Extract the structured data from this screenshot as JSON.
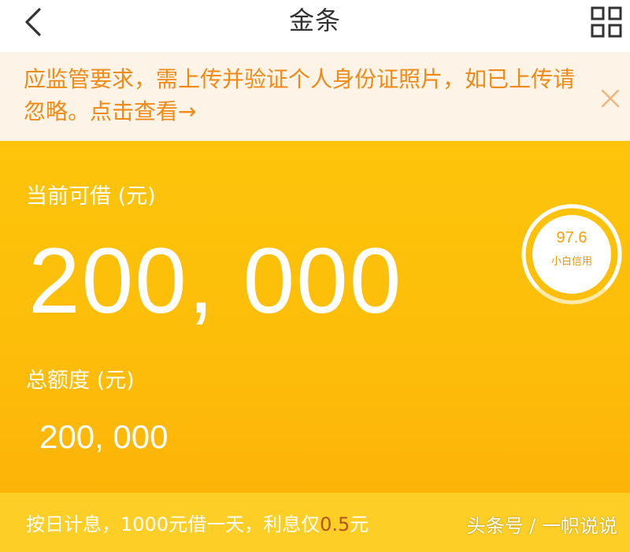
{
  "header": {
    "title": "金条",
    "back_icon": "chevron-left-icon",
    "menu_icon": "grid-icon"
  },
  "notice": {
    "text": "应监管要求，需上传并验证个人身份证照片，如已上传请忽略。点击查看→",
    "close_icon": "close-icon",
    "color": "#f08a17",
    "background": "#fdf3e7"
  },
  "credit": {
    "available_label": "当前可借 (元)",
    "available_amount": "200, 000",
    "total_label": "总额度 (元)",
    "total_amount": "200, 000",
    "background": "#fdc40b"
  },
  "score": {
    "value": "97.6",
    "label": "小白信用"
  },
  "bottom": {
    "text_before": "按日计息，1000元借一天，利息仅",
    "rate": "0.5",
    "text_after": "元",
    "rate_color": "#b3541e"
  },
  "watermark": "头条号 / 一帜说说"
}
